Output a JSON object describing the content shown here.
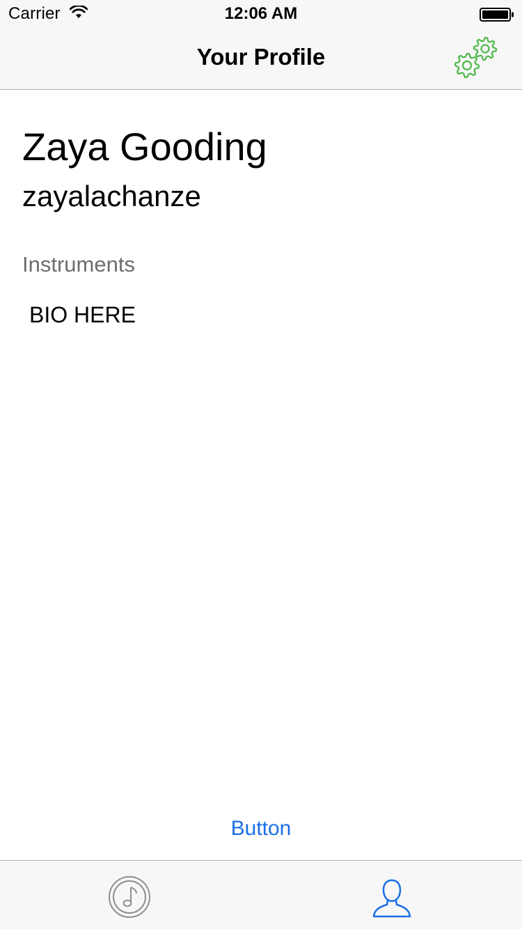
{
  "status_bar": {
    "carrier": "Carrier",
    "time": "12:06 AM",
    "wifi_icon": "wifi-icon",
    "battery_icon": "battery-icon"
  },
  "nav": {
    "title": "Your Profile",
    "settings_icon": "gears-icon",
    "settings_color": "#4cb848"
  },
  "profile": {
    "full_name": "Zaya Gooding",
    "username": "zayalachanze",
    "instruments_label": "Instruments",
    "bio": "BIO HERE"
  },
  "action_button": {
    "label": "Button",
    "color": "#1a6ee8"
  },
  "tab_bar": {
    "tabs": [
      {
        "icon": "music-note-icon",
        "selected": false,
        "color": "#8e8e8e"
      },
      {
        "icon": "person-icon",
        "selected": true,
        "color": "#1a6ee8"
      }
    ]
  }
}
